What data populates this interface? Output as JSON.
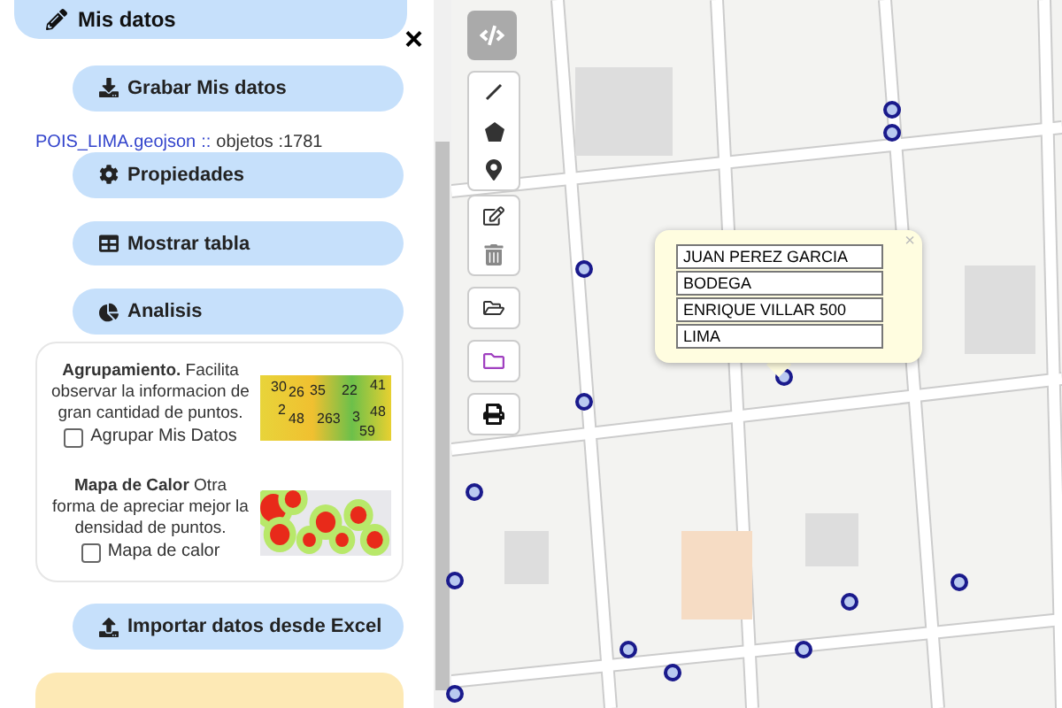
{
  "panel": {
    "header": "Mis datos",
    "close": "×",
    "buttons": [
      {
        "label": "Grabar Mis datos",
        "kind": "download"
      }
    ],
    "file": {
      "name": "POIS_LIMA.geojson",
      "separator": "::",
      "info": "objetos :1781"
    },
    "menu": [
      {
        "label": "Propiedades",
        "kind": "gear"
      },
      {
        "label": "Mostrar tabla",
        "kind": "table"
      },
      {
        "label": "Analisis",
        "kind": "pie"
      }
    ],
    "analysis": [
      {
        "kind": "cluster",
        "title": "Agrupamiento.",
        "text": "Facilita observar la informacion de gran cantidad de puntos.",
        "option": "Agrupar Mis Datos",
        "checked": false,
        "labels": [
          "30",
          "26",
          "35",
          "22",
          "41",
          "2",
          "48",
          "263",
          "3",
          "48",
          "59"
        ]
      },
      {
        "kind": "heat",
        "title": "Mapa de Calor",
        "text": "Otra forma de apreciar mejor la densidad de puntos.",
        "option": "Mapa de calor",
        "checked": false
      }
    ],
    "import": {
      "label": "Importar datos desde Excel"
    }
  },
  "popup": {
    "close": "×",
    "fields": [
      "JUAN PEREZ GARCIA",
      "BODEGA",
      "ENRIQUE VILLAR 500",
      "LIMA"
    ]
  }
}
